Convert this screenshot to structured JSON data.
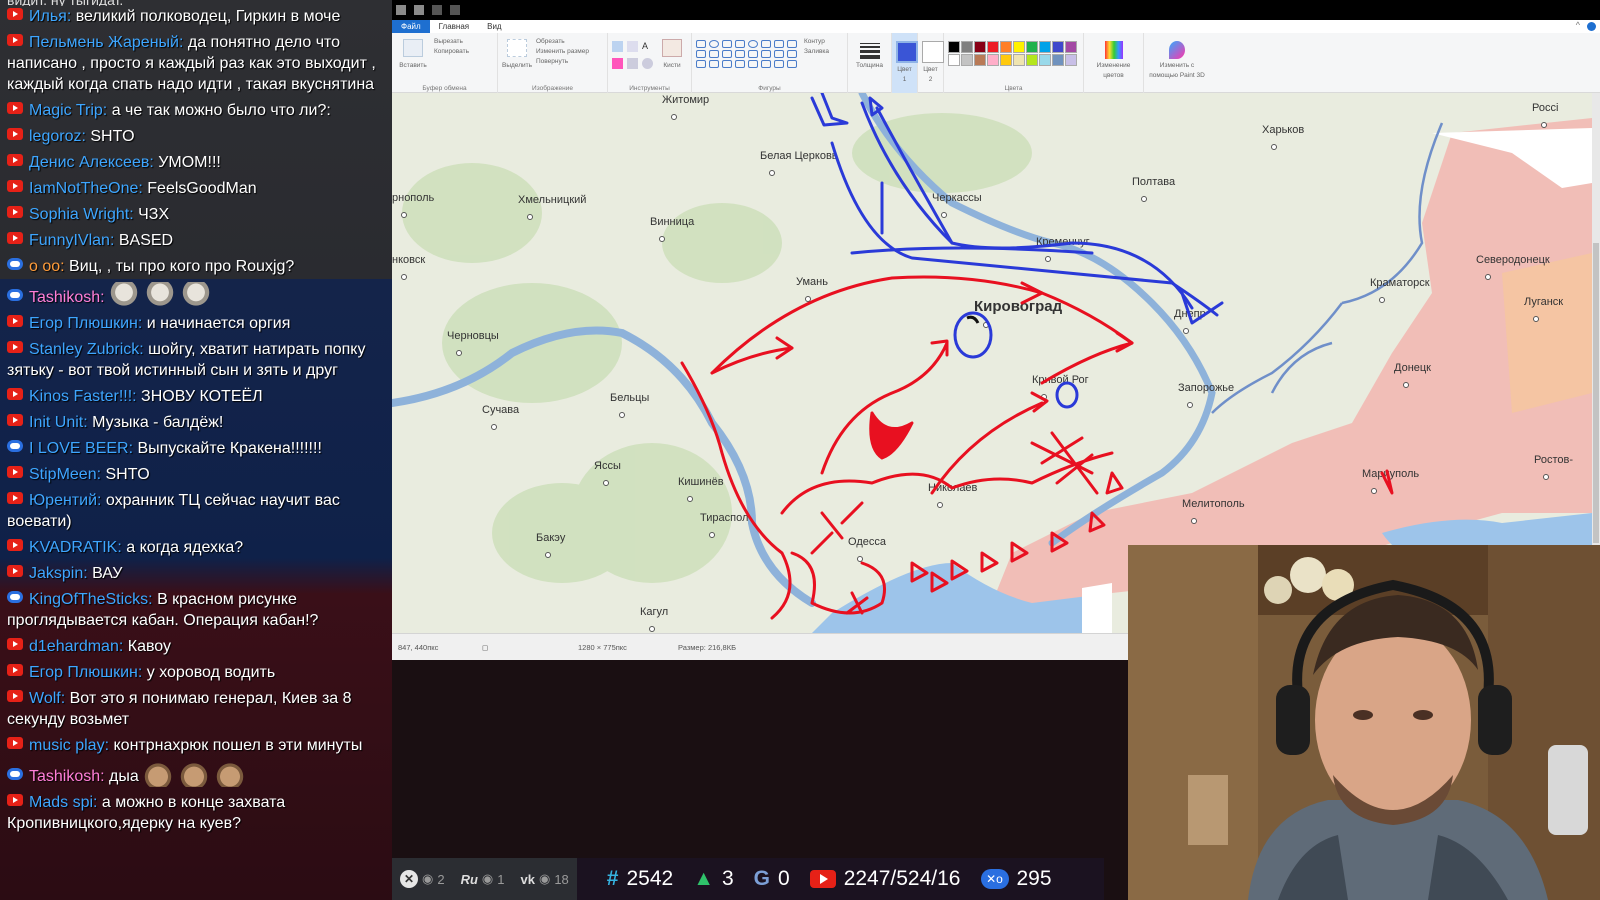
{
  "chat": {
    "messages": [
      {
        "badge": "yt",
        "nick": "Илья:",
        "nick_color": "blue",
        "text": "великий полководец, Гиркин в моче"
      },
      {
        "badge": "yt",
        "nick": "Пельмень Жареный:",
        "nick_color": "blue",
        "text": "да понятно дело что написано , просто я каждый раз как это выходит , каждый когда спать надо идти , такая вкуснятина"
      },
      {
        "badge": "yt",
        "nick": "Magic Trip:",
        "nick_color": "blue",
        "text": "а че так можно было что ли?:"
      },
      {
        "badge": "yt",
        "nick": "legoroz:",
        "nick_color": "blue",
        "text": "SHTO"
      },
      {
        "badge": "yt",
        "nick": "Денис Алексеев:",
        "nick_color": "blue",
        "text": "УМОМ!!!"
      },
      {
        "badge": "yt",
        "nick": "IamNotTheOne:",
        "nick_color": "blue",
        "text": "FeelsGoodMan"
      },
      {
        "badge": "yt",
        "nick": "Sophia Wright:",
        "nick_color": "blue",
        "text": "ЧЗХ"
      },
      {
        "badge": "yt",
        "nick": "FunnyIVlan:",
        "nick_color": "blue",
        "text": "BASED"
      },
      {
        "badge": "gg",
        "nick": "o oo:",
        "nick_color": "orange",
        "text": "Виц, , ты про кого про Rouxjg?"
      },
      {
        "badge": "gg",
        "nick": "Tashikosh:",
        "nick_color": "pink",
        "text": "",
        "emotes": [
          "gray",
          "gray",
          "gray"
        ]
      },
      {
        "badge": "yt",
        "nick": "Егор Плюшкин:",
        "nick_color": "blue",
        "text": "и начинается оргия"
      },
      {
        "badge": "yt",
        "nick": "Stanley Zubrick:",
        "nick_color": "blue",
        "text": "шойгу, хватит натирать попку зятьку - вот твой истинный сын и зять и друг"
      },
      {
        "badge": "yt",
        "nick": "Kinos Faster!!!:",
        "nick_color": "blue",
        "text": "ЗНОВУ КОТЕЁЛ"
      },
      {
        "badge": "yt",
        "nick": "Init Unit:",
        "nick_color": "blue",
        "text": "Музыка - балдёж!"
      },
      {
        "badge": "gg",
        "nick": "I LOVE BEER:",
        "nick_color": "blue",
        "text": "Выпускайте Кракена!!!!!!!"
      },
      {
        "badge": "yt",
        "nick": "StipMeen:",
        "nick_color": "blue",
        "text": "SHTO"
      },
      {
        "badge": "yt",
        "nick": "Юрентий:",
        "nick_color": "blue",
        "text": "охранник ТЦ сейчас научит вас воевати)"
      },
      {
        "badge": "yt",
        "nick": "KVADRATIK:",
        "nick_color": "blue",
        "text": "а когда ядехка?"
      },
      {
        "badge": "yt",
        "nick": "Jakspin:",
        "nick_color": "blue",
        "text": "ВАУ"
      },
      {
        "badge": "gg",
        "nick": "KingOfTheSticks:",
        "nick_color": "blue",
        "text": "В красном рисунке проглядывается кабан. Операция кабан!?"
      },
      {
        "badge": "yt",
        "nick": "d1ehardman:",
        "nick_color": "blue",
        "text": "Кавоу"
      },
      {
        "badge": "yt",
        "nick": "Егор Плюшкин:",
        "nick_color": "blue",
        "text": "у хоровод водить"
      },
      {
        "badge": "yt",
        "nick": "Wolf:",
        "nick_color": "blue",
        "text": "Вот это я понимаю генерал, Киев за 8 секунду возьмет"
      },
      {
        "badge": "yt",
        "nick": "music play:",
        "nick_color": "blue",
        "text": "контрнахрюк пошел в эти минуты"
      },
      {
        "badge": "gg",
        "nick": "Tashikosh:",
        "nick_color": "pink",
        "text": "дыа",
        "emotes": [
          "brown",
          "brown",
          "brown"
        ]
      },
      {
        "badge": "yt",
        "nick": "Mads spi:",
        "nick_color": "blue",
        "text": "а можно в конце захвата Кропивницкого,ядерку на куев?"
      }
    ]
  },
  "paint": {
    "tabs": [
      "Файл",
      "Главная",
      "Вид"
    ],
    "ribbon": {
      "clipboard": {
        "paste": "Вставить",
        "cut": "Вырезать",
        "copy": "Копировать",
        "group": "Буфер обмена"
      },
      "image": {
        "select": "Выделить",
        "crop": "Обрезать",
        "resize": "Изменить размер",
        "rotate": "Повернуть",
        "group": "Изображение"
      },
      "tools": {
        "brushes": "Кисти",
        "group": "Инструменты"
      },
      "shapes": {
        "outline": "Контур",
        "fill": "Заливка",
        "group": "Фигуры"
      },
      "size": "Толщина",
      "color1": "Цвет 1",
      "color2": "Цвет 2",
      "edit_colors": "Изменение цветов",
      "paint3d": "Изменить с помощью Paint 3D",
      "colors_group": "Цвета",
      "palette": [
        "#000000",
        "#7f7f7f",
        "#880015",
        "#ed1c24",
        "#ff7f27",
        "#fff200",
        "#22b14c",
        "#00a2e8",
        "#3f48cc",
        "#a349a4",
        "#ffffff",
        "#c3c3c3",
        "#b97a57",
        "#ffaec9",
        "#ffc90e",
        "#efe4b0",
        "#b5e61d",
        "#99d9ea",
        "#7092be",
        "#c8bfe7"
      ],
      "current_color": "#3a55d6"
    },
    "status": {
      "cursor": "847, 440пкс",
      "dims": "1280 × 775пкс",
      "size": "Размер: 216,8КБ"
    },
    "map_labels": [
      {
        "id": "zhytomyr",
        "text": "Житомир"
      },
      {
        "id": "belaya",
        "text": "Белая Церковь"
      },
      {
        "id": "kharkov",
        "text": "Харьков"
      },
      {
        "id": "rossiya",
        "text": "Россі"
      },
      {
        "id": "cherkassy",
        "text": "Черкассы"
      },
      {
        "id": "poltava",
        "text": "Полтава"
      },
      {
        "id": "rnopol",
        "text": "рнополь"
      },
      {
        "id": "khmelnitsky",
        "text": "Хмельницкий"
      },
      {
        "id": "vinnitsa",
        "text": "Винница"
      },
      {
        "id": "kremenchug",
        "text": "Кременчуг"
      },
      {
        "id": "severodonetsk",
        "text": "Северодонецк"
      },
      {
        "id": "nkovsk",
        "text": "нковск"
      },
      {
        "id": "uman",
        "text": "Умань"
      },
      {
        "id": "kirovograd",
        "text": "Кировоград"
      },
      {
        "id": "kramatorsk",
        "text": "Краматорск"
      },
      {
        "id": "lugansk",
        "text": "Луганск"
      },
      {
        "id": "dnepr",
        "text": "Днепр"
      },
      {
        "id": "chernovtsy",
        "text": "Черновцы"
      },
      {
        "id": "krivoy",
        "text": "Кривой Рог"
      },
      {
        "id": "zaporozhe",
        "text": "Запорожье"
      },
      {
        "id": "donetsk",
        "text": "Донецк"
      },
      {
        "id": "suchava",
        "text": "Сучава"
      },
      {
        "id": "beltsy",
        "text": "Бельцы"
      },
      {
        "id": "rostov",
        "text": "Ростов-"
      },
      {
        "id": "yassy",
        "text": "Яссы"
      },
      {
        "id": "mariupol",
        "text": "Мариуполь"
      },
      {
        "id": "kishinev",
        "text": "Кишинёв"
      },
      {
        "id": "nikolaev",
        "text": "Николаев"
      },
      {
        "id": "melitopol",
        "text": "Мелитополь"
      },
      {
        "id": "tiraspol",
        "text": "Тираспол"
      },
      {
        "id": "bakeu",
        "text": "Бакэу"
      },
      {
        "id": "odessa",
        "text": "Одесса"
      },
      {
        "id": "kagul",
        "text": "Кагул"
      }
    ]
  },
  "stats": {
    "platforms": [
      {
        "id": "p1",
        "icon": "x-icon",
        "count": "2"
      },
      {
        "id": "p2",
        "icon": "ru-icon",
        "label": "Ru",
        "count": "1"
      },
      {
        "id": "p3",
        "icon": "vk-icon",
        "label": "vk",
        "count": "18"
      }
    ],
    "hash_count": "2542",
    "up_count": "3",
    "g_count": "0",
    "youtube": "2247/524/16",
    "gg_count": "295"
  },
  "colors": {
    "accent": "#3ea6ff",
    "draw_red": "#e81020",
    "draw_blue": "#2a3ad8",
    "occupied": "#f2b6b0"
  }
}
